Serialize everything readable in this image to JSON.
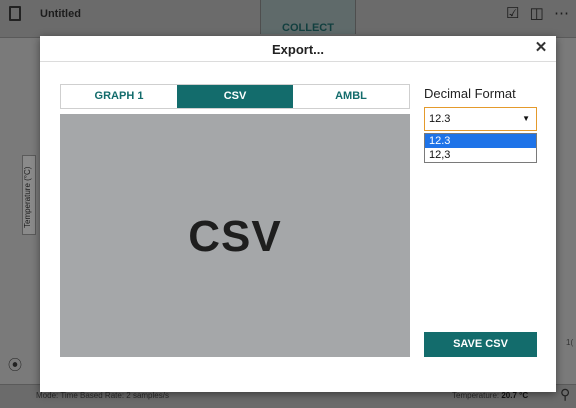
{
  "app": {
    "title": "Untitled",
    "collect_label": "COLLECT",
    "right_icons": "☑ ◫ ⋯",
    "side_label": "Temperature (°C)",
    "mode_text": "Mode: Time Based    Rate: 2 samples/s",
    "temp_label": "Temperature: ",
    "temp_value": "20.7 °C",
    "tick_label": "1("
  },
  "modal": {
    "title": "Export...",
    "close_glyph": "✕",
    "tabs": [
      {
        "label": "GRAPH 1",
        "active": false
      },
      {
        "label": "CSV",
        "active": true
      },
      {
        "label": "AMBL",
        "active": false
      }
    ],
    "preview_text": "CSV",
    "format_label": "Decimal Format",
    "format_selected": "12.3",
    "format_arrow": "▼",
    "format_options": [
      "12.3",
      "12,3"
    ],
    "save_label": "SAVE CSV"
  },
  "colors": {
    "accent": "#136c6c",
    "select_border": "#e49a2c",
    "option_highlight": "#1e73e8",
    "preview_bg": "#a5a7a9"
  }
}
